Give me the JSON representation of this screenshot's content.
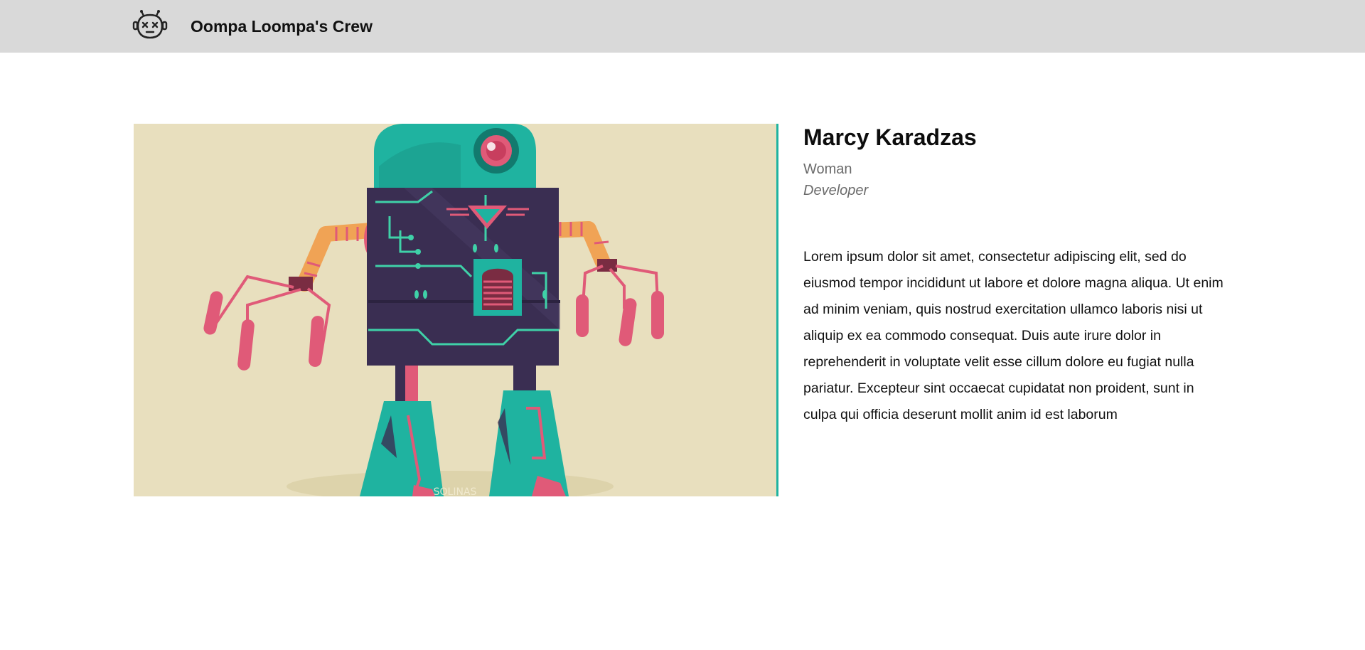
{
  "header": {
    "logo_icon": "robot-face-icon",
    "title": "Oompa Loompa's Crew",
    "background": "#d9d9d9"
  },
  "detail": {
    "image_icon": "robot-illustration",
    "image_signature": "SOLINAS",
    "name": "Marcy Karadzas",
    "gender": "Woman",
    "profession": "Developer",
    "description": "Lorem ipsum dolor sit amet, consectetur adipiscing elit, sed do eiusmod tempor incididunt ut labore et dolore magna aliqua. Ut enim ad minim veniam, quis nostrud exercitation ullamco laboris nisi ut aliquip ex ea commodo consequat. Duis aute irure dolor in reprehenderit in voluptate velit esse cillum dolore eu fugiat nulla pariatur. Excepteur sint occaecat cupidatat non proident, sunt in culpa qui officia deserunt mollit anim id est laborum"
  },
  "colors": {
    "teal": "#1fb3a0",
    "navy_body": "#3a2e52",
    "pink": "#e05a78",
    "orange": "#f0a355",
    "beige": "#e8dfbe"
  }
}
